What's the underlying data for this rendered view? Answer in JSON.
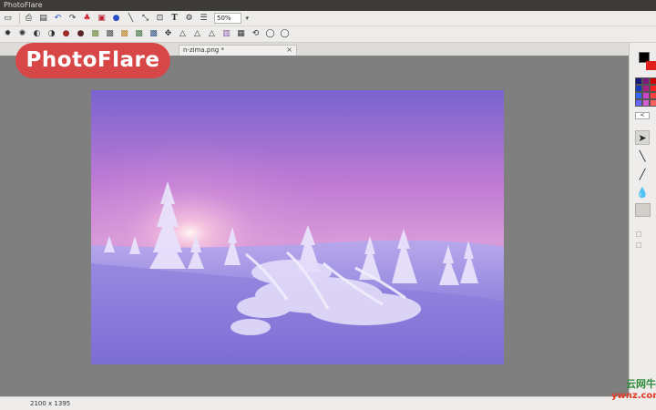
{
  "window": {
    "title": "PhotoFlare"
  },
  "toolbar_main": {
    "zoom_value": "50%",
    "icons": [
      "save-icon",
      "print-icon",
      "disk-icon",
      "undo-icon",
      "redo-icon",
      "colors-icon",
      "crop-icon",
      "palette-icon",
      "pen-icon",
      "resize-icon",
      "crop-select-icon",
      "text-icon",
      "gear-icon",
      "batch-icon"
    ]
  },
  "toolbar_filters": {
    "icons": [
      "brightness-icon",
      "contrast-icon",
      "half-tone-icon",
      "invert-icon",
      "circle-red-icon",
      "circle-gray-icon",
      "landscape-icon",
      "landscape-dark-icon",
      "landscape-warm-icon",
      "landscape-cool-icon",
      "landscape-blue-icon",
      "move-icon",
      "triangle-icon",
      "triangle-outline-icon",
      "triangle-small-icon",
      "gradient-icon",
      "histogram-icon",
      "rotate-left-icon",
      "rotate-right-icon",
      "flip-icon"
    ]
  },
  "tabs": [
    {
      "label": "n-zima.png *",
      "close": "×"
    }
  ],
  "right_panel": {
    "primary_color": "#000000",
    "secondary_color": "#e0201b",
    "palette": [
      "#1a1a7a",
      "#7a1a7a",
      "#cc0000",
      "#1a3ac0",
      "#aa2288",
      "#ff2020",
      "#3366ff",
      "#cc44cc",
      "#ff4040",
      "#6666ff",
      "#d35fd3",
      "#ff6060"
    ],
    "palette_nav": "<",
    "tools": [
      "pointer-icon",
      "line-icon",
      "brush-icon",
      "drop-icon",
      "select-box-icon"
    ]
  },
  "status": {
    "dimensions": "2100 x 1395"
  },
  "overlay": {
    "logo_text": "PhotoFlare"
  },
  "watermark": {
    "line1": "云网牛",
    "line2": "ywnz.com"
  }
}
